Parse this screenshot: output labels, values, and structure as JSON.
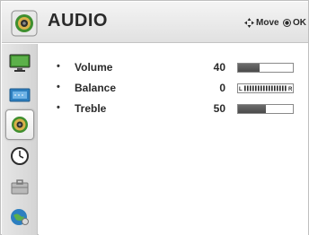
{
  "header": {
    "title": "AUDIO",
    "icon": "speaker-icon",
    "hints": [
      {
        "label": "Move",
        "icon": "navigation-arrows-icon"
      },
      {
        "label": "OK",
        "icon": "ok-button-icon"
      }
    ]
  },
  "sidebar": {
    "items": [
      {
        "name": "picture",
        "icon": "monitor-icon"
      },
      {
        "name": "screen",
        "icon": "screen-icon"
      },
      {
        "name": "audio",
        "icon": "speaker-icon",
        "active": true
      },
      {
        "name": "time",
        "icon": "clock-icon"
      },
      {
        "name": "settings",
        "icon": "toolbox-icon"
      },
      {
        "name": "support",
        "icon": "globe-person-icon"
      }
    ]
  },
  "settings": [
    {
      "label": "Volume",
      "value": "40",
      "level": 0.4
    },
    {
      "label": "Balance",
      "value": "0",
      "level": 0.5
    },
    {
      "label": "Treble",
      "value": "50",
      "level": 0.5
    }
  ],
  "colors": {
    "bar_fill": "#555555",
    "icon_green": "#3f8f2f",
    "icon_blue": "#2d7fc0"
  }
}
